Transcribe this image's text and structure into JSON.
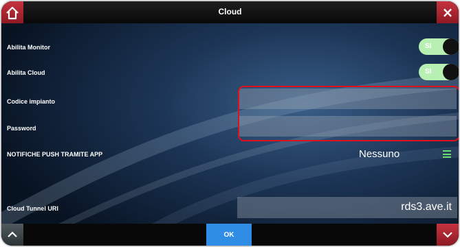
{
  "header": {
    "title": "Cloud",
    "close_glyph": "×"
  },
  "icons": {
    "home": "home-icon",
    "close": "close-icon",
    "scroll_up": "chevron-up-icon",
    "scroll_down": "chevron-down-icon",
    "menu": "hamburger-menu-icon"
  },
  "rows": {
    "monitor": {
      "label": "Abilita Monitor",
      "toggle_text": "SI",
      "enabled": true
    },
    "cloud": {
      "label": "Abilita Cloud",
      "toggle_text": "SI",
      "enabled": true
    },
    "codice": {
      "label": "Codice impianto",
      "value": ""
    },
    "password": {
      "label": "Password",
      "value": ""
    },
    "notifiche": {
      "label": "NOTIFICHE PUSH TRAMITE APP",
      "value": "Nessuno"
    },
    "tunnel": {
      "label": "Cloud Tunnel URI",
      "value": "rds3.ave.it"
    }
  },
  "footer": {
    "ok_label": "OK"
  },
  "colors": {
    "accent_blue": "#2f8de6",
    "danger_red": "#c5333f",
    "toggle_on": "#b8efb3",
    "menu_green": "#69dc72",
    "highlight_red": "#e3101c"
  }
}
